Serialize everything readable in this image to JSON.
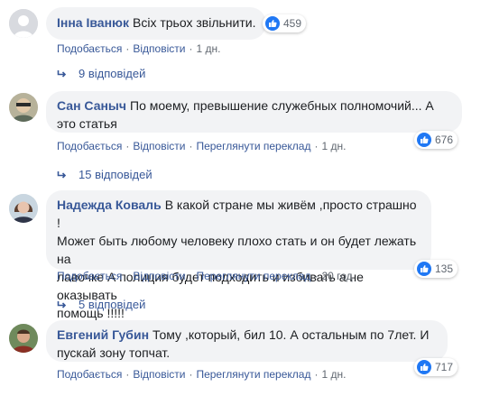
{
  "comments": [
    {
      "author": "Інна Іванюк",
      "text": "Всіх трьох звільнити.",
      "reactions": "459",
      "like": "Подобається",
      "reply": "Відповісти",
      "time": "1 дн.",
      "replies": "9 відповідей"
    },
    {
      "author": "Сан Саныч",
      "text_line1": "По моему, превышение служебных полномочий... А",
      "text_line2": "это статья",
      "reactions": "676",
      "like": "Подобається",
      "reply": "Відповісти",
      "translate": "Переглянути переклад",
      "time": "1 дн.",
      "replies": "15 відповідей"
    },
    {
      "author": "Надежда Коваль",
      "text_line1": "В какой стране мы живём ,просто страшно !",
      "text_line2": "Может быть любому человеку плохо стать и он будет лежать на",
      "text_line3": "лавочке А полиция будет подходить и избивать а не оказывать",
      "text_line4": "помощь !!!!!",
      "reactions": "135",
      "like": "Подобається",
      "reply": "Відповісти",
      "translate": "Переглянути переклад",
      "time": "20 год",
      "replies": "5 відповідей"
    },
    {
      "author": "Евгений Губин",
      "text_line1": "Тому ,который, бил 10. А остальным по 7лет. И",
      "text_line2": "пускай зону топчат.",
      "reactions": "717",
      "like": "Подобається",
      "reply": "Відповісти",
      "translate": "Переглянути переклад",
      "time": "1 дн."
    }
  ],
  "icons": {
    "reaction": "like-icon",
    "reply_arrow": "reply-arrow-icon"
  },
  "colors": {
    "author": "#385898",
    "bubble": "#f2f3f5",
    "like": "#2078f4",
    "meta": "#606770"
  }
}
